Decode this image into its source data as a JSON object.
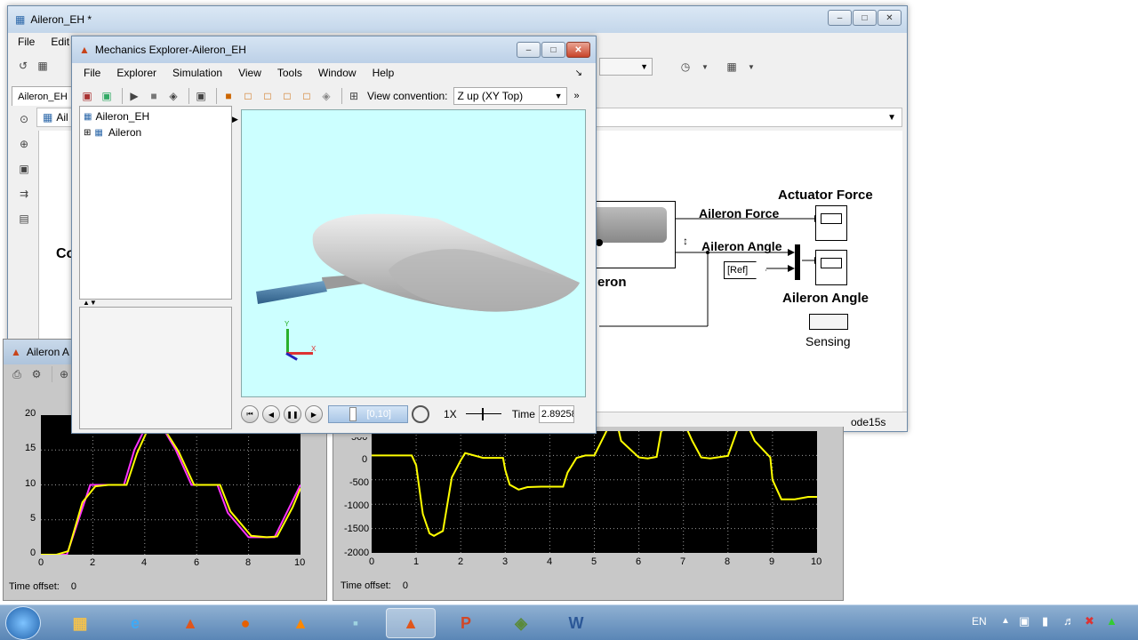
{
  "simulink": {
    "title": "Aileron_EH *",
    "menu": [
      "File",
      "Edit"
    ],
    "tab": "Aileron_EH",
    "breadcrumb": "Ail",
    "left_label": "Co",
    "status": "ode15s",
    "blocks": {
      "actuator_force_title": "Actuator Force",
      "aileron_force_label": "Aileron Force",
      "aileron_angle_label": "Aileron Angle",
      "aileron_angle_title": "Aileron Angle",
      "ref_tag": "[Ref]",
      "sensing_label": "Sensing",
      "subsystem_label": "eron"
    }
  },
  "mechanics": {
    "title": "Mechanics Explorer-Aileron_EH",
    "menu": [
      "File",
      "Explorer",
      "Simulation",
      "View",
      "Tools",
      "Window",
      "Help"
    ],
    "view_convention_label": "View convention:",
    "view_convention_value": "Z up (XY Top)",
    "tree": {
      "root": "Aileron_EH",
      "child": "Aileron"
    },
    "playback": {
      "range": "[0,10]",
      "speed": "1X",
      "time_label": "Time",
      "time_value": "2.89258",
      "progress": 0.2893
    },
    "axes": {
      "y": "Y",
      "x": "X"
    }
  },
  "scope_left": {
    "title": "Aileron A",
    "time_offset_label": "Time offset:",
    "time_offset_value": "0",
    "yticks": [
      "20",
      "15",
      "10",
      "5",
      "0"
    ],
    "xticks": [
      "0",
      "2",
      "4",
      "6",
      "8",
      "10"
    ]
  },
  "scope_right": {
    "time_offset_label": "Time offset:",
    "time_offset_value": "0",
    "yticks": [
      "500",
      "0",
      "-500",
      "-1000",
      "-1500",
      "-2000"
    ],
    "xticks": [
      "0",
      "1",
      "2",
      "3",
      "4",
      "5",
      "6",
      "7",
      "8",
      "9",
      "10"
    ]
  },
  "taskbar": {
    "lang": "EN",
    "apps": [
      "start-orb",
      "explorer",
      "ie",
      "matlab",
      "firefox",
      "vlc",
      "notepad",
      "matlab-active",
      "powerpoint",
      "simscape",
      "word"
    ]
  },
  "chart_data": [
    {
      "type": "line",
      "xlim": [
        0,
        10
      ],
      "ylim": [
        0,
        20
      ],
      "grid": true,
      "series": [
        {
          "color": "#ff33ff",
          "x": [
            0,
            0.6,
            1.0,
            1.9,
            2.4,
            3.2,
            3.6,
            4.0,
            4.4,
            5.2,
            5.8,
            6.8,
            7.2,
            8.0,
            8.6,
            9.0,
            9.6,
            10.0
          ],
          "y": [
            0,
            0,
            0,
            10,
            10,
            10,
            15,
            18,
            20,
            15,
            10,
            10,
            6,
            2.5,
            2.5,
            2.5,
            7,
            10
          ]
        },
        {
          "color": "#ffff00",
          "x": [
            0,
            0.6,
            1.05,
            1.6,
            2.1,
            2.6,
            3.3,
            3.7,
            4.1,
            4.5,
            5.3,
            5.9,
            6.9,
            7.3,
            8.1,
            8.7,
            9.1,
            9.7,
            10.0
          ],
          "y": [
            0,
            0,
            0.5,
            7.5,
            9.8,
            10,
            10,
            14.5,
            17.8,
            19.5,
            14.8,
            10,
            10,
            6.2,
            2.7,
            2.5,
            2.6,
            6.8,
            9.5
          ]
        }
      ]
    },
    {
      "type": "line",
      "xlim": [
        0,
        10
      ],
      "ylim": [
        -2000,
        500
      ],
      "grid": true,
      "series": [
        {
          "color": "#ffff00",
          "x": [
            0,
            0.9,
            1.0,
            1.15,
            1.3,
            1.4,
            1.6,
            1.7,
            1.8,
            2.0,
            2.1,
            2.5,
            2.95,
            3.0,
            3.1,
            3.3,
            3.5,
            3.8,
            4.0,
            4.3,
            4.4,
            4.6,
            4.8,
            5.0,
            5.3,
            5.5,
            5.6,
            6.0,
            6.2,
            6.4,
            6.5,
            7.0,
            7.2,
            7.4,
            7.6,
            8.0,
            8.2,
            8.4,
            8.6,
            8.95,
            9.0,
            9.2,
            9.5,
            9.8,
            10.0
          ],
          "y": [
            0,
            0,
            -200,
            -1200,
            -1600,
            -1650,
            -1550,
            -1000,
            -450,
            -100,
            50,
            -50,
            -50,
            -300,
            -600,
            -700,
            -650,
            -640,
            -640,
            -640,
            -350,
            -50,
            0,
            0,
            550,
            700,
            300,
            -40,
            -60,
            -30,
            500,
            700,
            300,
            -40,
            -60,
            -10,
            500,
            700,
            300,
            -40,
            -500,
            -900,
            -900,
            -850,
            -850
          ]
        }
      ]
    }
  ]
}
